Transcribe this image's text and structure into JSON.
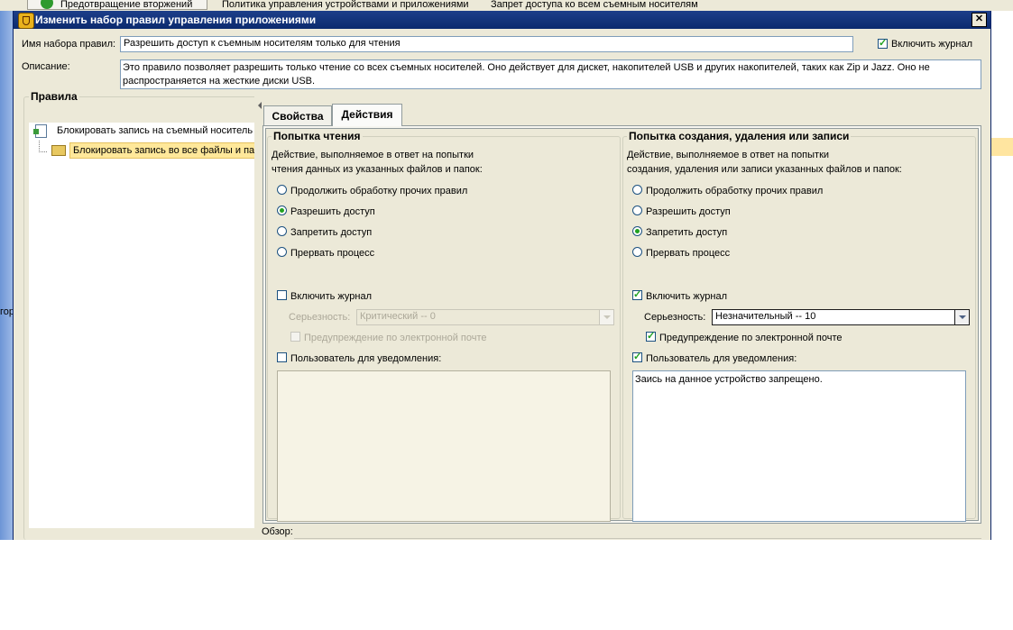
{
  "background": {
    "tab1": "Предотвращение вторжений",
    "tab2": "Политика управления устройствами и приложениями",
    "tab3": "Запрет доступа ко всем съемным носителям",
    "left_label": "гор"
  },
  "dialog": {
    "title": "Изменить набор правил управления приложениями",
    "close_label": "✕",
    "ruleset_name_label": "Имя набора правил:",
    "ruleset_name_value": "Разрешить доступ к съемным носителям только для чтения",
    "enable_log_label": "Включить журнал",
    "description_label": "Описание:",
    "description_line1": "Это правило позволяет разрешить только чтение со всех съемных носителей.   Оно действует для дискет, накопителей USB и других накопителей, таких как Zip и Jazz.  Оно не",
    "description_line2": "распространяется на жесткие диски USB."
  },
  "rules_panel": {
    "title": "Правила",
    "items": [
      {
        "label": "Блокировать запись на съемный носитель"
      },
      {
        "label": "Блокировать запись во все файлы и па"
      }
    ]
  },
  "tabs": [
    {
      "label": "Свойства"
    },
    {
      "label": "Действия"
    }
  ],
  "read_attempt": {
    "title": "Попытка чтения",
    "desc_line1": "Действие, выполняемое в ответ на попытки",
    "desc_line2": "чтения данных из указанных файлов и папок:",
    "options": [
      "Продолжить обработку прочих правил",
      "Разрешить доступ",
      "Запретить доступ",
      "Прервать процесс"
    ],
    "selected": "Разрешить доступ",
    "enable_log_label": "Включить журнал",
    "severity_label": "Серьезность:",
    "severity_value": "Критический -- 0",
    "email_label": "Предупреждение по электронной почте",
    "notify_user_label": "Пользователь для уведомления:",
    "notify_text": ""
  },
  "write_attempt": {
    "title": "Попытка создания, удаления или записи",
    "desc_line1": "Действие, выполняемое в ответ на попытки",
    "desc_line2": "создания, удаления или записи указанных файлов и папок:",
    "options": [
      "Продолжить обработку прочих правил",
      "Разрешить доступ",
      "Запретить доступ",
      "Прервать процесс"
    ],
    "selected": "Запретить доступ",
    "enable_log_label": "Включить журнал",
    "severity_label": "Серьезность:",
    "severity_value": "Незначительный -- 10",
    "email_label": "Предупреждение по электронной почте",
    "notify_user_label": "Пользователь для уведомления:",
    "notify_text": "Заись на данное устройство запрещено."
  },
  "footer": {
    "overview_label": "Обзор:"
  }
}
